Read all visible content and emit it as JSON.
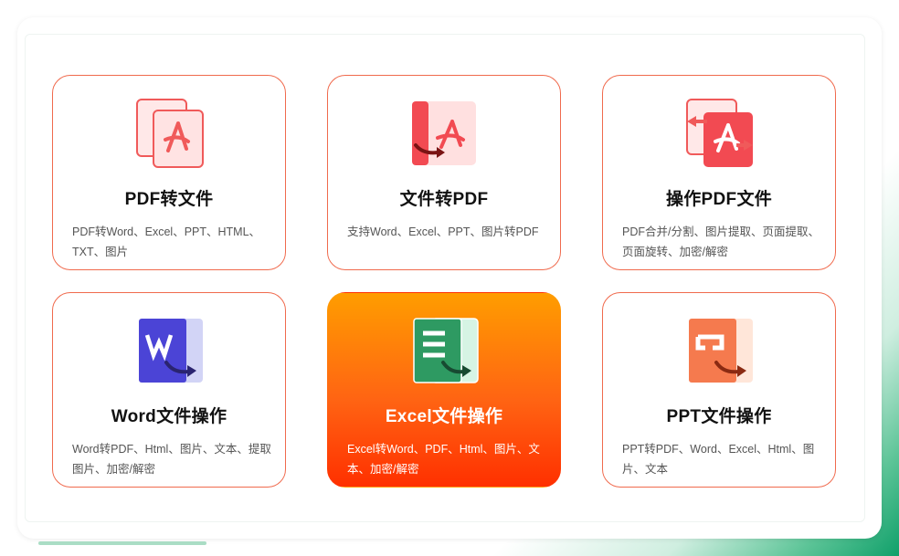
{
  "colors": {
    "accent": "#f06a4d",
    "active_gradient_top": "#ff9d00",
    "active_gradient_bottom": "#ff3000",
    "background_green": "#10a06a"
  },
  "cards": [
    {
      "icon": "pdf-to-file-icon",
      "title": "PDF转文件",
      "desc": "PDF转Word、Excel、PPT、HTML、TXT、图片"
    },
    {
      "icon": "file-to-pdf-icon",
      "title": "文件转PDF",
      "desc": "支持Word、Excel、PPT、图片转PDF"
    },
    {
      "icon": "pdf-operate-icon",
      "title": "操作PDF文件",
      "desc": "PDF合并/分割、图片提取、页面提取、页面旋转、加密/解密"
    },
    {
      "icon": "word-icon",
      "title": "Word文件操作",
      "desc": "Word转PDF、Html、图片、文本、提取图片、加密/解密"
    },
    {
      "icon": "excel-icon",
      "title": "Excel文件操作",
      "desc": "Excel转Word、PDF、Html、图片、文本、加密/解密",
      "active": true
    },
    {
      "icon": "ppt-icon",
      "title": "PPT文件操作",
      "desc": "PPT转PDF、Word、Excel、Html、图片、文本"
    }
  ]
}
